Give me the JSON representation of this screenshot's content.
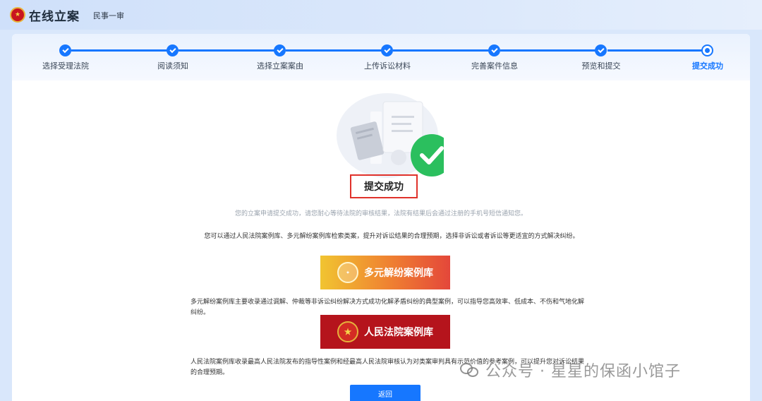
{
  "header": {
    "app_title": "在线立案",
    "subtitle": "民事一审"
  },
  "steps": [
    {
      "label": "选择受理法院",
      "status": "done"
    },
    {
      "label": "阅读须知",
      "status": "done"
    },
    {
      "label": "选择立案案由",
      "status": "done"
    },
    {
      "label": "上传诉讼材料",
      "status": "done"
    },
    {
      "label": "完善案件信息",
      "status": "done"
    },
    {
      "label": "预览和提交",
      "status": "done"
    },
    {
      "label": "提交成功",
      "status": "current"
    }
  ],
  "result": {
    "title": "提交成功",
    "description": "您的立案申请提交成功，请您耐心等待法院的审核结果，法院有结果后会通过注册的手机号短信通知您。",
    "intro": "您可以通过人民法院案例库、多元解纷案例库检索类案，提升对诉讼结果的合理预期，选择非诉讼或者诉讼等更适宜的方式解决纠纷。"
  },
  "banners": {
    "diversified": {
      "label": "多元解纷案例库",
      "description": "多元解纷案例库主要收录通过调解、仲裁等非诉讼纠纷解决方式成功化解矛盾纠纷的典型案例，可以指导您高效率、低成本、不伤和气地化解纠纷。"
    },
    "court": {
      "label": "人民法院案例库",
      "description": "人民法院案例库收录最高人民法院发布的指导性案例和经最高人民法院审核认为对类案审判具有示范价值的参考案例，可以提升您对诉讼结果的合理预期。"
    }
  },
  "actions": {
    "back_label": "返回"
  },
  "watermark": {
    "text": "公众号 · 星星的保函小馆子"
  },
  "colors": {
    "primary": "#1677ff",
    "success": "#2bbf5e",
    "highlight_border": "#e0322b"
  }
}
